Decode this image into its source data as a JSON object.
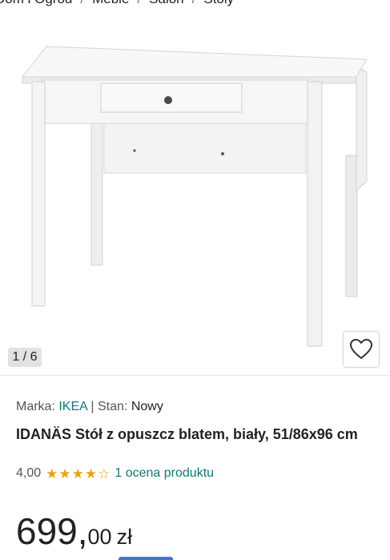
{
  "breadcrumb": {
    "items": [
      "Dom i Ogród",
      "Meble",
      "Salon",
      "Stoły"
    ],
    "separator": "/"
  },
  "gallery": {
    "counter": "1 / 6",
    "favorite_icon": "heart-outline-icon"
  },
  "product": {
    "brand_label": "Marka:",
    "brand": "IKEA",
    "meta_separator": "|",
    "condition_label": "Stan:",
    "condition": "Nowy",
    "title": "IDANÄS Stół z opuszcz blatem, biały, 51/86x96 cm",
    "rating_value": "4,00",
    "rating_stars": 4,
    "rating_max": 5,
    "reviews_link": "1 ocena produktu",
    "price_main": "699,",
    "price_fraction": "00",
    "price_currency": "zł"
  },
  "colors": {
    "link": "#0b7a75",
    "star": "#e5a513",
    "text": "#222222"
  }
}
